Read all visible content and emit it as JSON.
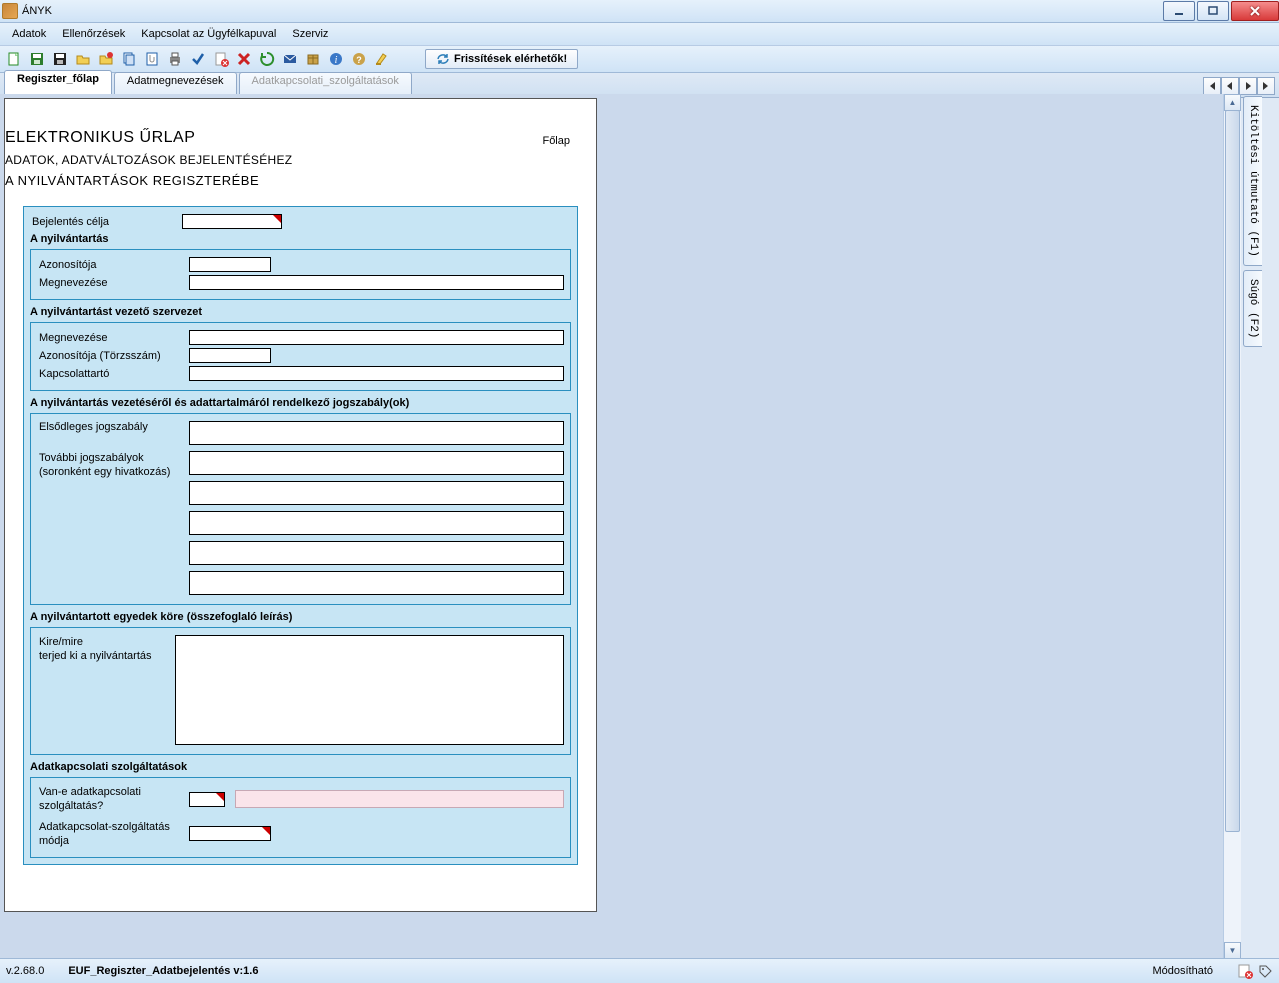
{
  "window": {
    "title": "ÁNYK"
  },
  "menu": {
    "items": [
      "Adatok",
      "Ellenőrzések",
      "Kapcsolat az Ügyfélkapuval",
      "Szerviz"
    ]
  },
  "toolbar": {
    "icons": [
      "new",
      "save",
      "save-black",
      "open",
      "open-marked",
      "copy",
      "attach",
      "print",
      "check",
      "error",
      "delete",
      "recycle",
      "send",
      "package",
      "info",
      "help",
      "highlight"
    ],
    "update_label": "Frissítések elérhetők!"
  },
  "tabs": {
    "items": [
      {
        "label": "Regiszter_főlap",
        "active": true,
        "disabled": false
      },
      {
        "label": "Adatmegnevezések",
        "active": false,
        "disabled": false
      },
      {
        "label": "Adatkapcsolati_szolgáltatások",
        "active": false,
        "disabled": true
      }
    ]
  },
  "sidetabs": {
    "help_guide": "Kitöltési útmutató (F1)",
    "help": "Súgó (F2)"
  },
  "form": {
    "corner": "Főlap",
    "title1": "ELEKTRONIKUS ŰRLAP",
    "title2": "ADATOK, ADATVÁLTOZÁSOK BEJELENTÉSÉHEZ",
    "title3": "A NYILVÁNTARTÁSOK REGISZTERÉBE",
    "s1_label_purpose": "Bejelentés célja",
    "s1_heading": "A nyilvántartás",
    "s1_id": "Azonosítója",
    "s1_name": "Megnevezése",
    "s2_heading": "A nyilvántartást vezető szervezet",
    "s2_name": "Megnevezése",
    "s2_id": "Azonosítója (Törzsszám)",
    "s2_contact": "Kapcsolattartó",
    "s3_heading": "A nyilvántartás vezetéséről és adattartalmáról rendelkező jogszabály(ok)",
    "s3_primary": "Elsődleges jogszabály",
    "s3_more1": "További jogszabályok",
    "s3_more2": "(soronként egy hivatkozás)",
    "s4_heading": "A nyilvántartott egyedek köre (összefoglaló leírás)",
    "s4_who1": "Kire/mire",
    "s4_who2": "terjed ki a nyilvántartás",
    "s5_heading": "Adatkapcsolati szolgáltatások",
    "s5_q1a": "Van-e adatkapcsolati",
    "s5_q1b": "szolgáltatás?",
    "s5_q2a": "Adatkapcsolat-szolgáltatás",
    "s5_q2b": "módja"
  },
  "status": {
    "version": "v.2.68.0",
    "doc": "EUF_Regiszter_Adatbejelentés v:1.6",
    "state": "Módosítható"
  }
}
